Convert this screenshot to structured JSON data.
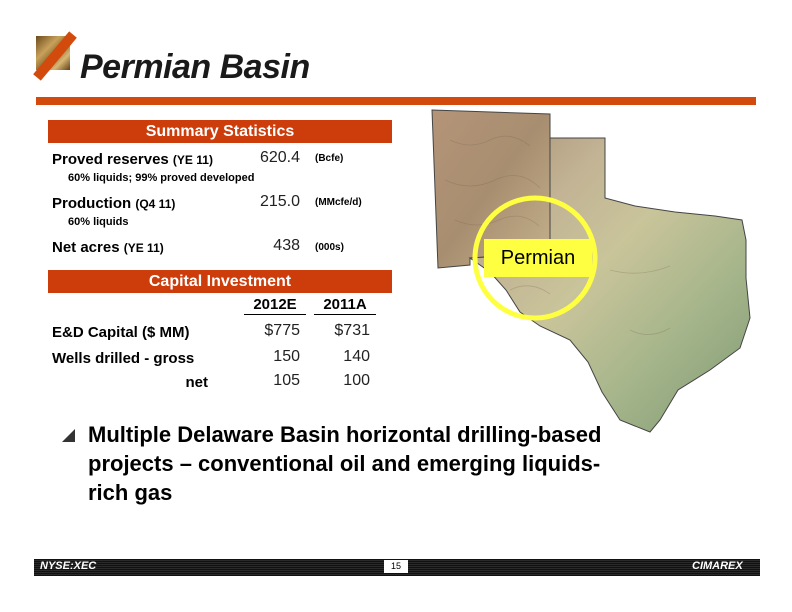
{
  "title": "Permian Basin",
  "summary": {
    "header": "Summary Statistics",
    "rows": [
      {
        "label": "Proved reserves",
        "period": "(YE 11)",
        "value": "620.4",
        "unit": "(Bcfe)",
        "note": "60% liquids;  99% proved developed"
      },
      {
        "label": "Production",
        "period": "(Q4 11)",
        "value": "215.0",
        "unit": "(MMcfe/d)",
        "note": "60% liquids"
      },
      {
        "label": "Net acres",
        "period": "(YE 11)",
        "value": "438",
        "unit": "(000s)"
      }
    ]
  },
  "capital": {
    "header": "Capital Investment",
    "columns": [
      "2012E",
      "2011A"
    ],
    "rows": [
      {
        "label": "E&D Capital ($ MM)",
        "values": [
          "$775",
          "$731"
        ]
      },
      {
        "label": "Wells drilled - gross",
        "values": [
          "150",
          "140"
        ]
      },
      {
        "label": "net",
        "values": [
          "105",
          "100"
        ]
      }
    ]
  },
  "map": {
    "label": "Permian",
    "highlight_color": "#ffff42"
  },
  "bullet": "Multiple Delaware Basin horizontal drilling-based projects – conventional oil and emerging liquids-rich gas",
  "footer": {
    "ticker": "NYSE:XEC",
    "page": "15",
    "brand": "CIMAREX"
  },
  "colors": {
    "accent": "#d24a0c",
    "header_fill": "#cc3d0b"
  }
}
